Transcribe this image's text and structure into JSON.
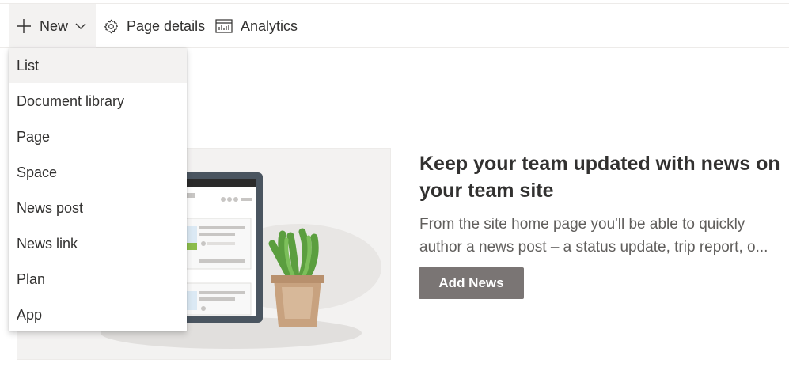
{
  "command_bar": {
    "new_label": "New",
    "page_details_label": "Page details",
    "analytics_label": "Analytics"
  },
  "new_menu": {
    "items": [
      {
        "label": "List"
      },
      {
        "label": "Document library"
      },
      {
        "label": "Page"
      },
      {
        "label": "Space"
      },
      {
        "label": "News post"
      },
      {
        "label": "News link"
      },
      {
        "label": "Plan"
      },
      {
        "label": "App"
      }
    ],
    "highlighted_item": "List"
  },
  "news_placeholder": {
    "title": "Keep your team updated with news on your team site",
    "description": "From the site home page you'll be able to quickly author a news post – a status update, trip report, o...",
    "button_label": "Add News"
  },
  "colors": {
    "accent_button": "#7a7574",
    "menu_highlight": "#f3f2f1",
    "text_primary": "#323130",
    "text_secondary": "#605e5c"
  },
  "icons": {
    "new": "plus-icon",
    "new_chevron": "chevron-down-icon",
    "page_details": "gear-icon",
    "analytics": "analytics-chart-icon"
  }
}
